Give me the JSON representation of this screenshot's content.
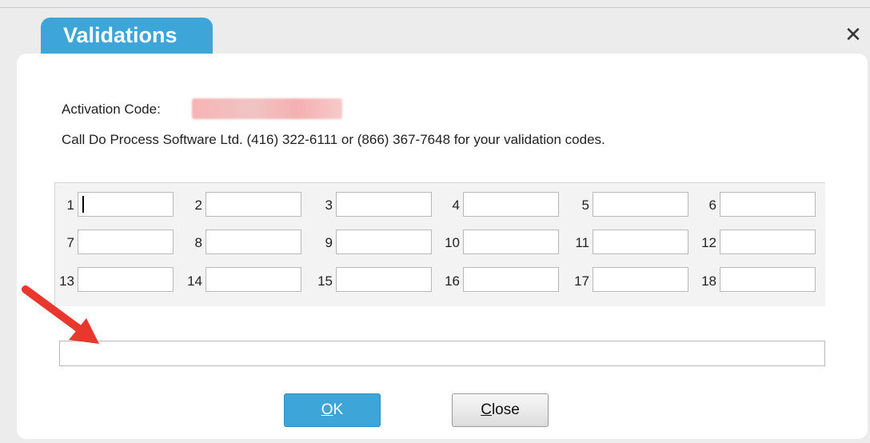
{
  "dialog": {
    "title": "Validations",
    "close_glyph": "✕"
  },
  "activation": {
    "label": "Activation Code:"
  },
  "instructions": "Call Do Process Software Ltd. (416) 322-6111 or (866) 367-7648 for your validation codes.",
  "validation_fields": [
    {
      "num": "1"
    },
    {
      "num": "2"
    },
    {
      "num": "3"
    },
    {
      "num": "4"
    },
    {
      "num": "5"
    },
    {
      "num": "6"
    },
    {
      "num": "7"
    },
    {
      "num": "8"
    },
    {
      "num": "9"
    },
    {
      "num": "10"
    },
    {
      "num": "11"
    },
    {
      "num": "12"
    },
    {
      "num": "13"
    },
    {
      "num": "14"
    },
    {
      "num": "15"
    },
    {
      "num": "16"
    },
    {
      "num": "17"
    },
    {
      "num": "18"
    }
  ],
  "buttons": {
    "ok_mnemonic": "O",
    "ok_rest": "K",
    "close_mnemonic": "C",
    "close_rest": "lose"
  },
  "colors": {
    "accent": "#3ea5d9",
    "annotation_arrow": "#e8372d"
  }
}
